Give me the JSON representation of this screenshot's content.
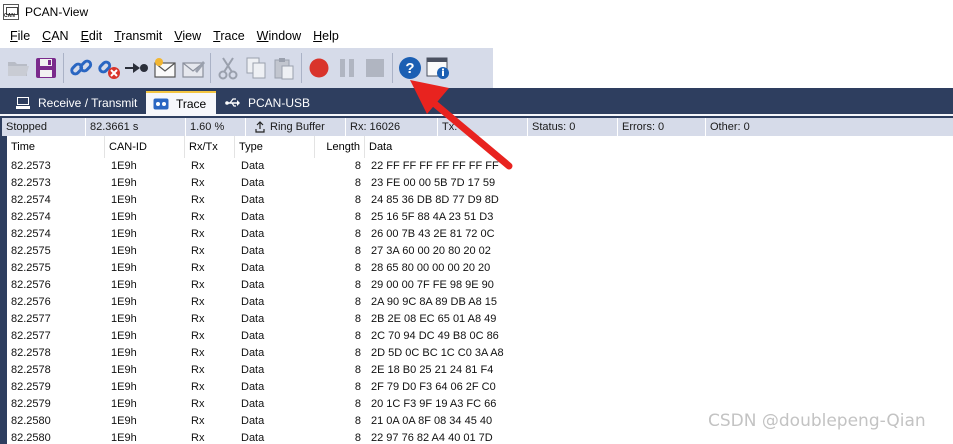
{
  "window": {
    "title": "PCAN-View"
  },
  "menu": [
    {
      "label": "File",
      "mnemonic": "F",
      "rest": "ile"
    },
    {
      "label": "CAN",
      "mnemonic": "C",
      "rest": "AN"
    },
    {
      "label": "Edit",
      "mnemonic": "E",
      "rest": "dit"
    },
    {
      "label": "Transmit",
      "mnemonic": "T",
      "rest": "ransmit"
    },
    {
      "label": "View",
      "mnemonic": "V",
      "rest": "iew"
    },
    {
      "label": "Trace",
      "mnemonic": "T",
      "rest": "race"
    },
    {
      "label": "Window",
      "mnemonic": "W",
      "rest": "indow"
    },
    {
      "label": "Help",
      "mnemonic": "H",
      "rest": "elp"
    }
  ],
  "toolbar": {
    "icons": [
      "open-folder-icon",
      "save-icon",
      "connect-icon",
      "disconnect-icon",
      "plug-icon",
      "new-message-icon",
      "edit-message-icon",
      "cut-icon",
      "copy-icon",
      "paste-icon",
      "record-icon",
      "pause-icon",
      "stop-icon",
      "help-icon",
      "about-icon"
    ],
    "record_color": "#d9342b",
    "help_color": "#1b5fb3"
  },
  "tabs": [
    {
      "label": "Receive / Transmit",
      "active": false
    },
    {
      "label": "Trace",
      "active": true
    },
    {
      "label": "PCAN-USB",
      "active": false
    }
  ],
  "status": {
    "state": "Stopped",
    "time": "82.3661 s",
    "buffer_pct": "1.60 %",
    "buffer_mode": "Ring Buffer",
    "rx": "Rx: 16026",
    "tx": "Tx:",
    "status": "Status: 0",
    "errors": "Errors: 0",
    "other": "Other: 0"
  },
  "trace": {
    "columns": [
      "Time",
      "CAN-ID",
      "Rx/Tx",
      "Type",
      "Length",
      "Data"
    ],
    "rows": [
      [
        "82.2573",
        "1E9h",
        "Rx",
        "Data",
        "8",
        "22 FF FF FF FF FF FF FF"
      ],
      [
        "82.2573",
        "1E9h",
        "Rx",
        "Data",
        "8",
        "23 FE 00 00 5B 7D 17 59"
      ],
      [
        "82.2574",
        "1E9h",
        "Rx",
        "Data",
        "8",
        "24 85 36 DB 8D 77 D9 8D"
      ],
      [
        "82.2574",
        "1E9h",
        "Rx",
        "Data",
        "8",
        "25 16 5F 88 4A 23 51 D3"
      ],
      [
        "82.2574",
        "1E9h",
        "Rx",
        "Data",
        "8",
        "26 00 7B 43 2E 81 72 0C"
      ],
      [
        "82.2575",
        "1E9h",
        "Rx",
        "Data",
        "8",
        "27 3A 60 00 20 80 20 02"
      ],
      [
        "82.2575",
        "1E9h",
        "Rx",
        "Data",
        "8",
        "28 65 80 00 00 00 20 20"
      ],
      [
        "82.2576",
        "1E9h",
        "Rx",
        "Data",
        "8",
        "29 00 00 7F FE 98 9E 90"
      ],
      [
        "82.2576",
        "1E9h",
        "Rx",
        "Data",
        "8",
        "2A 90 9C 8A 89 DB A8 15"
      ],
      [
        "82.2577",
        "1E9h",
        "Rx",
        "Data",
        "8",
        "2B 2E 08 EC 65 01 A8 49"
      ],
      [
        "82.2577",
        "1E9h",
        "Rx",
        "Data",
        "8",
        "2C 70 94 DC 49 B8 0C 86"
      ],
      [
        "82.2578",
        "1E9h",
        "Rx",
        "Data",
        "8",
        "2D 5D 0C BC 1C C0 3A A8"
      ],
      [
        "82.2578",
        "1E9h",
        "Rx",
        "Data",
        "8",
        "2E 18 B0 25 21 24 81 F4"
      ],
      [
        "82.2579",
        "1E9h",
        "Rx",
        "Data",
        "8",
        "2F 79 D0 F3 64 06 2F C0"
      ],
      [
        "82.2579",
        "1E9h",
        "Rx",
        "Data",
        "8",
        "20 1C F3 9F 19 A3 FC 66"
      ],
      [
        "82.2580",
        "1E9h",
        "Rx",
        "Data",
        "8",
        "21 0A 0A 8F 08 34 45 40"
      ],
      [
        "82.2580",
        "1E9h",
        "Rx",
        "Data",
        "8",
        "22 97 76 82 A4 40 01 7D"
      ]
    ]
  },
  "annotation": {
    "arrow_color": "#e8231f"
  },
  "watermark": "CSDN @doublepeng-Qian"
}
